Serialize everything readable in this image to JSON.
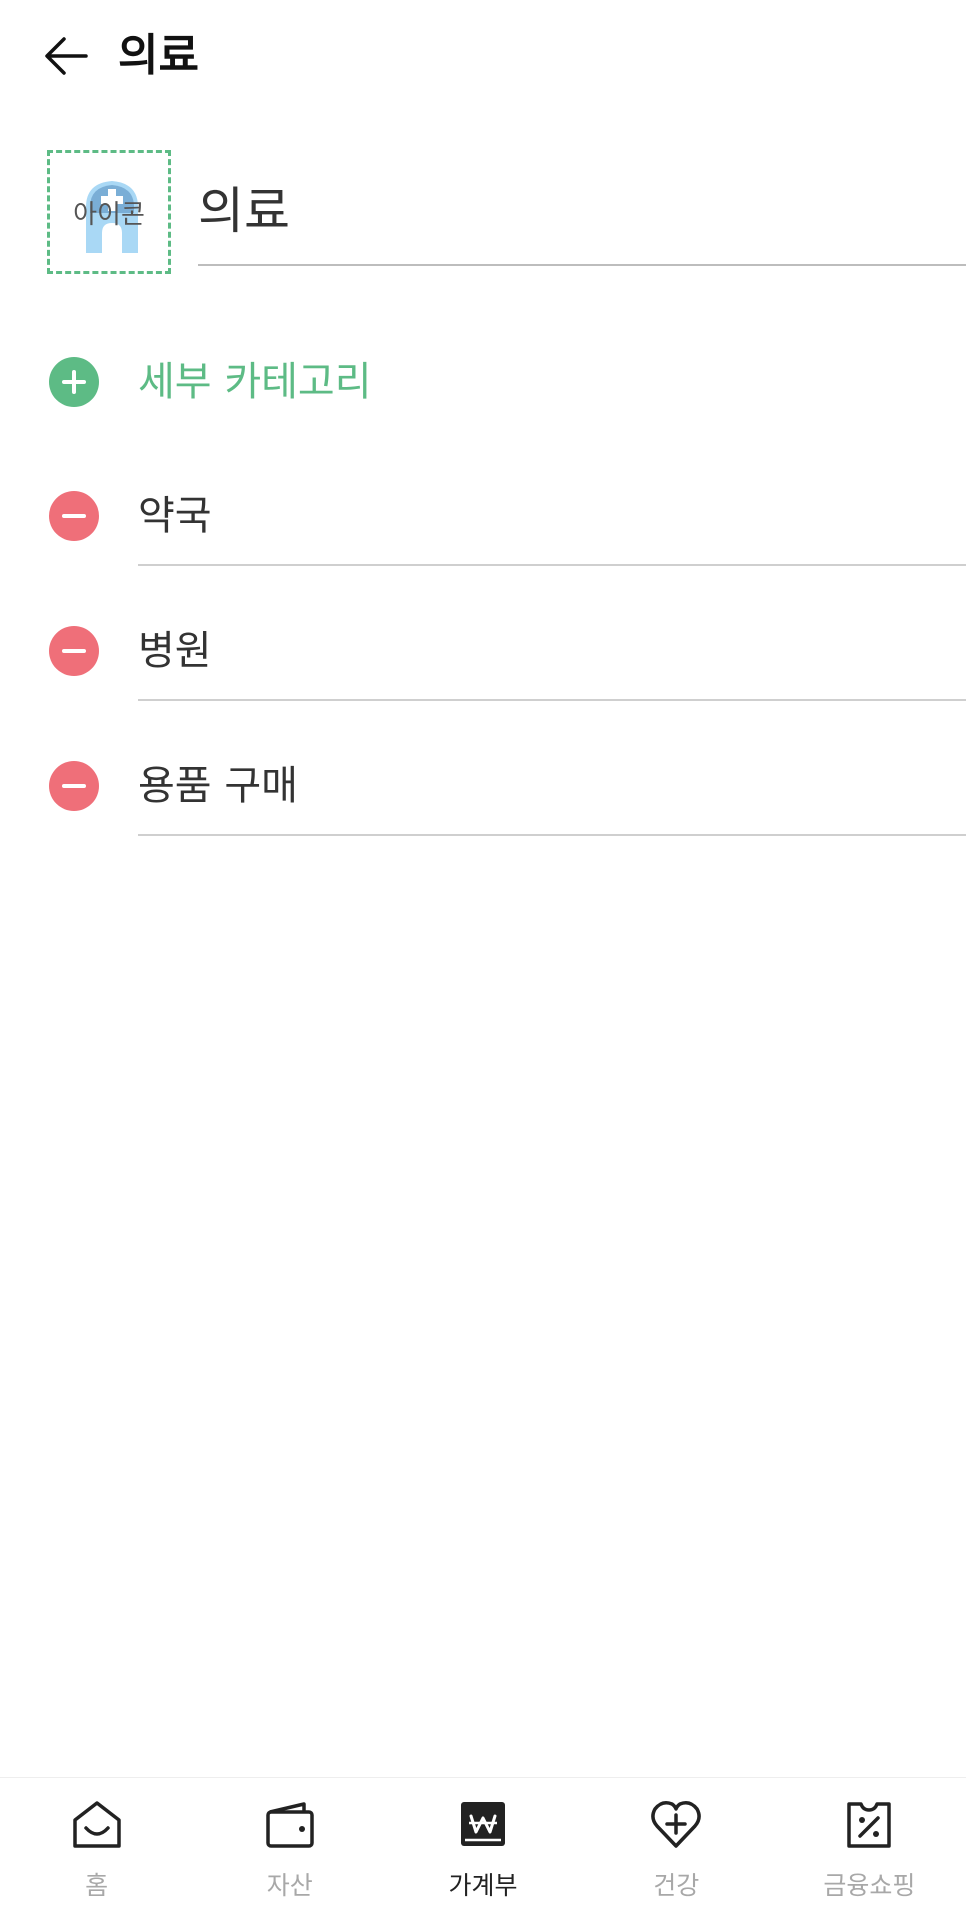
{
  "header": {
    "title": "의료"
  },
  "category": {
    "icon_label": "아이콘",
    "name": "의료"
  },
  "add_subcategory": {
    "label": "세부 카테고리"
  },
  "subcategories": [
    {
      "label": "약국"
    },
    {
      "label": "병원"
    },
    {
      "label": "용품 구매"
    }
  ],
  "colors": {
    "accent_green": "#5dbb85",
    "remove_red": "#ef6f79",
    "nav_inactive": "#a8a8a8",
    "nav_active": "#222222"
  },
  "bottom_nav": {
    "items": [
      {
        "label": "홈",
        "icon": "home-icon",
        "active": false
      },
      {
        "label": "자산",
        "icon": "wallet-icon",
        "active": false
      },
      {
        "label": "가계부",
        "icon": "ledger-icon",
        "active": true
      },
      {
        "label": "건강",
        "icon": "health-heart-icon",
        "active": false
      },
      {
        "label": "금융쇼핑",
        "icon": "coupon-icon",
        "active": false
      }
    ]
  }
}
